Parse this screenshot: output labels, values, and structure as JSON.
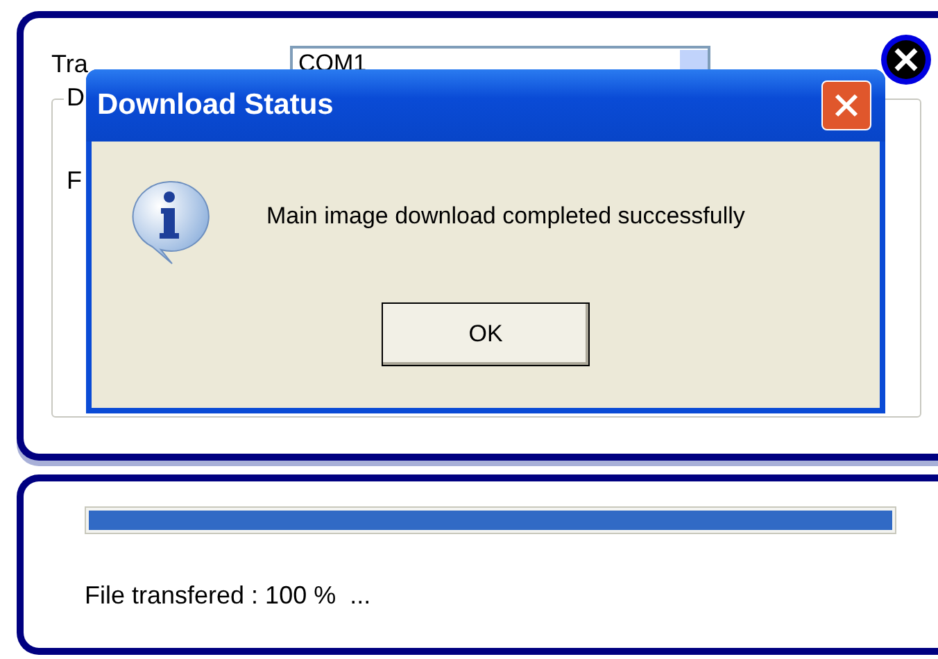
{
  "settings_panel": {
    "label": "Tra",
    "port_combo": {
      "value": "COM1"
    },
    "group_label": "D",
    "field_label": "F"
  },
  "dialog": {
    "title": "Download Status",
    "message": "Main image download completed successfully",
    "buttons": [
      "OK"
    ]
  },
  "progress_panel": {
    "level": 1.0,
    "status": "File transfered : 100 %  ..."
  }
}
